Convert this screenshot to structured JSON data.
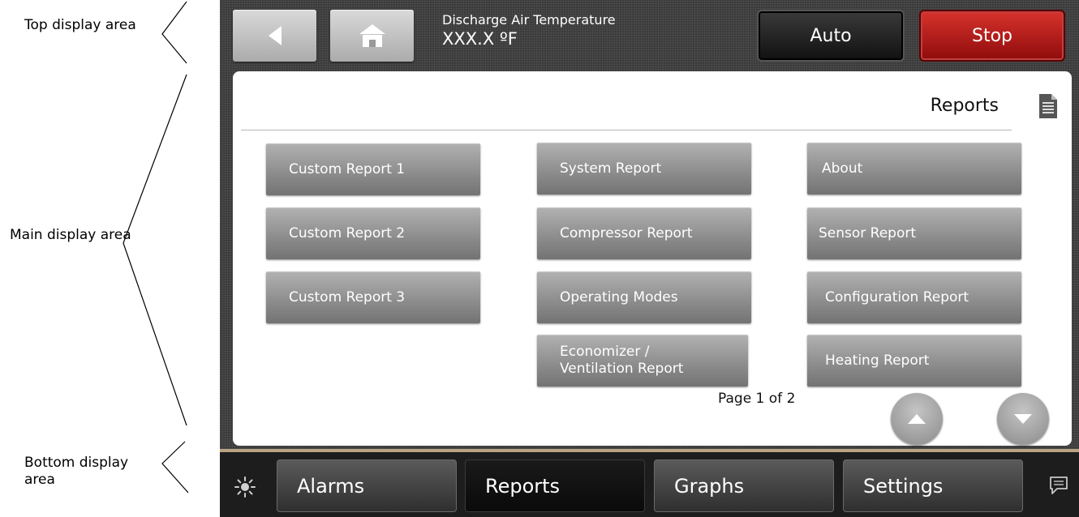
{
  "callouts": {
    "top": "Top display area",
    "main": "Main display area",
    "bottom": "Bottom display area"
  },
  "topbar": {
    "status_label": "Discharge Air Temperature",
    "status_value": "XXX.X ºF",
    "auto_label": "Auto",
    "stop_label": "Stop"
  },
  "main": {
    "section_title": "Reports",
    "buttons": [
      "Custom Report 1",
      "Custom Report 2",
      "Custom Report 3",
      "System Report",
      "Compressor Report",
      "Operating Modes",
      "Economizer / Ventilation Report",
      "About",
      "Sensor Report",
      "Configuration Report",
      "Heating Report"
    ],
    "page_indicator": "Page 1 of 2"
  },
  "bottom": {
    "tabs": [
      "Alarms",
      "Reports",
      "Graphs",
      "Settings"
    ],
    "active_tab": "Reports"
  },
  "icons": {
    "back": "back-arrow-icon",
    "home": "home-icon",
    "document": "document-icon",
    "page_up": "chevron-up-icon",
    "page_down": "chevron-down-icon",
    "brightness": "brightness-icon",
    "messages": "chat-bubble-icon"
  },
  "colors": {
    "stop_button": "#c41e1a",
    "auto_button": "#1a1a1a",
    "report_button": "#8e8e8e",
    "accent_line": "#b9a383"
  }
}
